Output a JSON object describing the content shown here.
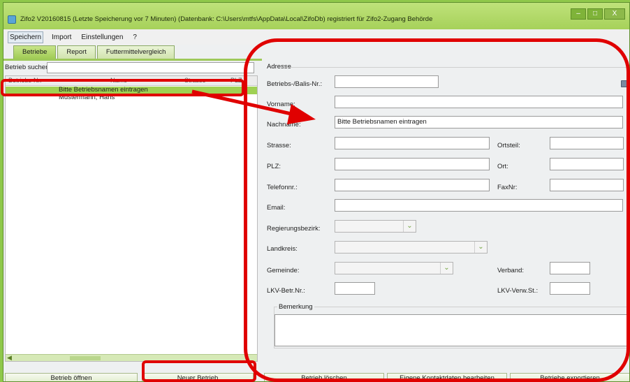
{
  "window": {
    "title": "Zifo2 V20160815 (Letzte Speicherung vor 7 Minuten) (Datenbank: C:\\Users\\mtfs\\AppData\\Local\\ZifoDb) registriert für Zifo2-Zugang Behörde",
    "controls": [
      "–",
      "□",
      "X"
    ]
  },
  "menu": [
    "Speichern",
    "Import",
    "Einstellungen",
    "?"
  ],
  "tabs": [
    "Betriebe",
    "Report",
    "Futtermittelvergleich"
  ],
  "left": {
    "search_label": "Betrieb suchen:",
    "search_value": "",
    "columns": [
      "Betriebs-Nr.",
      "Name",
      "Strasse",
      "PLZ"
    ],
    "rows": [
      {
        "name": "Bitte Betriebsnamen eintragen",
        "selected": true
      },
      {
        "name": "Mustermann, Hans",
        "selected": false
      }
    ],
    "buttons": {
      "open": "Betrieb öffnen",
      "new": "Neuer Betrieb"
    }
  },
  "form": {
    "group_title": "Adresse",
    "labels": {
      "betriebsnr": "Betriebs-/Balis-Nr.:",
      "vorname": "Vorname:",
      "nachname": "Nachname:",
      "strasse": "Strasse:",
      "ortsteil": "Ortsteil:",
      "plz": "PLZ:",
      "ort": "Ort:",
      "telefon": "Telefonnr.:",
      "faxnr": "FaxNr:",
      "email": "Email:",
      "regbezirk": "Regierungsbezirk:",
      "landkreis": "Landkreis:",
      "gemeinde": "Gemeinde:",
      "verband": "Verband:",
      "lkvbetr": "LKV-Betr.Nr.:",
      "lkvverw": "LKV-Verw.St.:",
      "bemerkung": "Bemerkung"
    },
    "values": {
      "nachname": "Bitte Betriebsnamen eintragen"
    },
    "buttons": {
      "delete": "Betrieb löschen",
      "contact": "Eigene Kontaktdaten bearbeiten",
      "export": "Betriebe exportieren"
    }
  },
  "icons": {
    "print": "printer-icon",
    "dropdown": "chevron-down-icon"
  },
  "colors": {
    "accent": "#9fd153",
    "annotation": "#e00000"
  }
}
